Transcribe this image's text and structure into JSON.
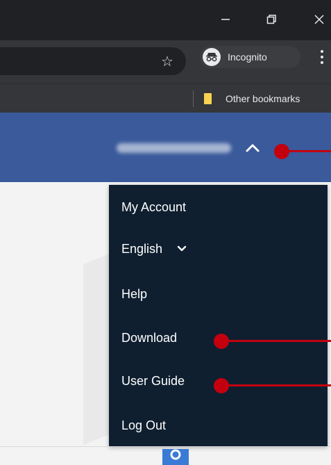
{
  "browser": {
    "incognito_label": "Incognito",
    "bookmarks": {
      "other_label": "Other bookmarks"
    }
  },
  "menu": {
    "items": [
      {
        "label": "My Account"
      },
      {
        "label": "English"
      },
      {
        "label": "Help"
      },
      {
        "label": "Download"
      },
      {
        "label": "User Guide"
      },
      {
        "label": "Log Out"
      }
    ]
  },
  "colors": {
    "header_blue": "#3a5a9b",
    "menu_bg": "#0f1f30",
    "annotation_red": "#c4000f",
    "search_blue": "#3a7bd5"
  },
  "icons": [
    "minimize-icon",
    "restore-icon",
    "close-icon",
    "star-icon",
    "incognito-icon",
    "kebab-menu-icon",
    "folder-icon",
    "chevron-up-icon",
    "chevron-down-icon",
    "search-icon"
  ]
}
